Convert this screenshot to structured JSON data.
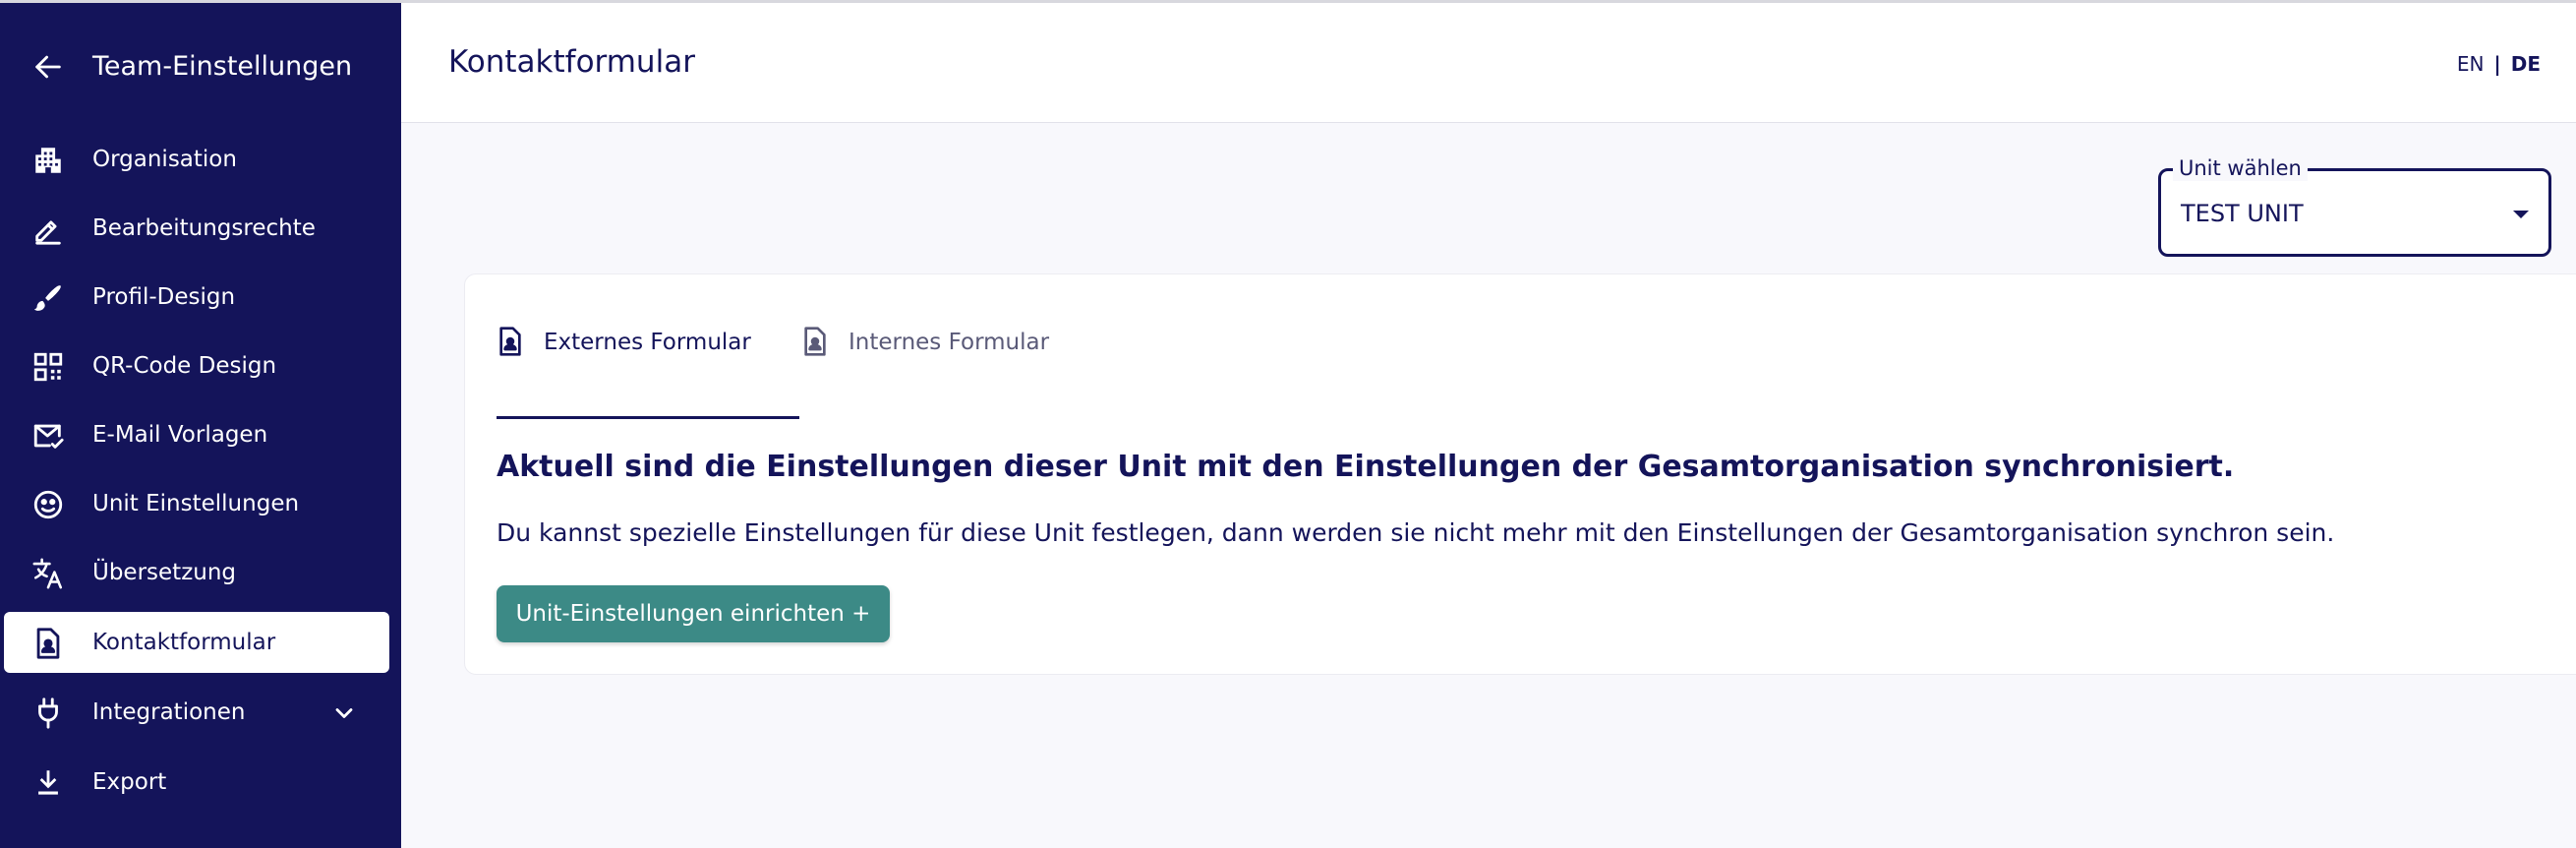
{
  "sidebar": {
    "title": "Team-Einstellungen",
    "back_icon": "arrow-left-icon",
    "items": [
      {
        "label": "Organisation",
        "icon": "building-icon"
      },
      {
        "label": "Bearbeitungsrechte",
        "icon": "edit-pen-icon"
      },
      {
        "label": "Profil-Design",
        "icon": "brush-icon"
      },
      {
        "label": "QR-Code Design",
        "icon": "qr-code-icon"
      },
      {
        "label": "E-Mail Vorlagen",
        "icon": "mail-check-icon"
      },
      {
        "label": "Unit Einstellungen",
        "icon": "face-settings-icon"
      },
      {
        "label": "Übersetzung",
        "icon": "translate-icon"
      },
      {
        "label": "Kontaktformular",
        "icon": "contact-form-icon",
        "active": true
      },
      {
        "label": "Integrationen",
        "icon": "plug-icon",
        "expandable": true
      },
      {
        "label": "Export",
        "icon": "download-icon"
      }
    ]
  },
  "header": {
    "title": "Kontaktformular",
    "lang_en": "EN",
    "lang_sep": "|",
    "lang_de": "DE",
    "active_lang": "DE"
  },
  "unit_select": {
    "label": "Unit wählen",
    "value": "TEST UNIT"
  },
  "tabs": [
    {
      "label": "Externes Formular",
      "icon": "contact-form-icon",
      "active": true
    },
    {
      "label": "Internes Formular",
      "icon": "contact-form-icon",
      "active": false
    }
  ],
  "content": {
    "heading": "Aktuell sind die Einstellungen dieser Unit mit den Einstellungen der Gesamtorganisation synchronisiert.",
    "text": "Du kannst spezielle Einstellungen für diese Unit festlegen, dann werden sie nicht mehr mit den Einstellungen der Gesamtorganisation synchron sein.",
    "button": "Unit-Einstellungen einrichten +"
  },
  "colors": {
    "sidebar_bg": "#14145a",
    "accent": "#14145a",
    "button_bg": "#3c8a86",
    "page_bg": "#f8f8fc"
  }
}
